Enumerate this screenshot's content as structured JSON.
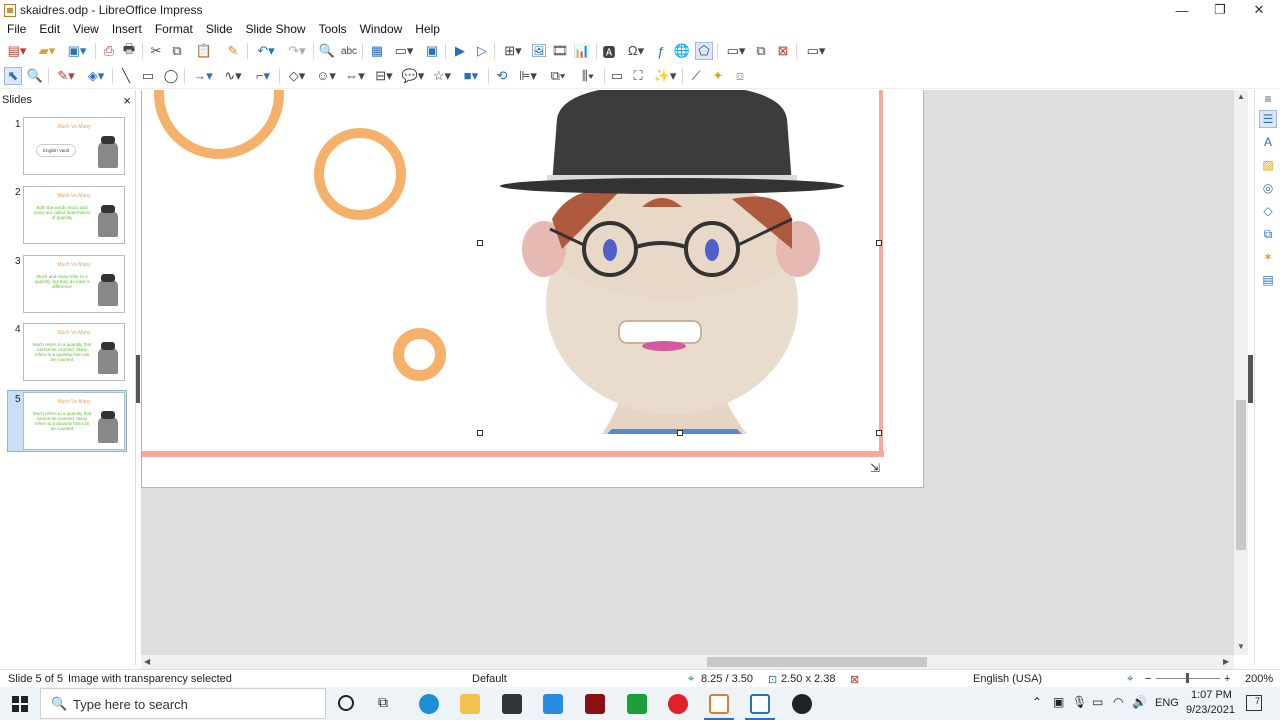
{
  "window": {
    "title": "skaidres.odp - LibreOffice Impress",
    "minimize": "—",
    "restore": "❐",
    "close": "✕"
  },
  "menu": [
    "File",
    "Edit",
    "View",
    "Insert",
    "Format",
    "Slide",
    "Slide Show",
    "Tools",
    "Window",
    "Help"
  ],
  "slides_panel": {
    "header": "Slides",
    "close": "×",
    "thumbs": [
      {
        "num": "1",
        "title": "Much Vs Many",
        "body": "English Vault"
      },
      {
        "num": "2",
        "title": "Much Vs Many",
        "body": "Both the words much and many are called determiners of quantity"
      },
      {
        "num": "3",
        "title": "Much Vs Many",
        "body": "Much and many refer to a quantity, but they do have a difference"
      },
      {
        "num": "4",
        "title": "Much Vs Many",
        "body": "Much refers to a quantity that cannot be counted. Many refers to a quantity that can be counted"
      },
      {
        "num": "5",
        "title": "Much Vs Many",
        "body": "Much refers to a quantity that cannot be counted. Many refers to a quantity that can be counted"
      }
    ]
  },
  "statusbar": {
    "slide": "Slide 5 of 5",
    "selection": "Image with transparency selected",
    "layout": "Default",
    "position": "8.25 / 3.50",
    "size": "2.50 x 2.38",
    "language": "English (USA)",
    "zoom": "200%"
  },
  "taskbar": {
    "search_placeholder": "Type here to search",
    "lang": "ENG",
    "time": "1:07 PM",
    "date": "9/23/2021",
    "notif": "7"
  },
  "colors": {
    "ring": "#f5b06a",
    "frame": "#f4a99a",
    "accent": "#2a6fb8"
  }
}
